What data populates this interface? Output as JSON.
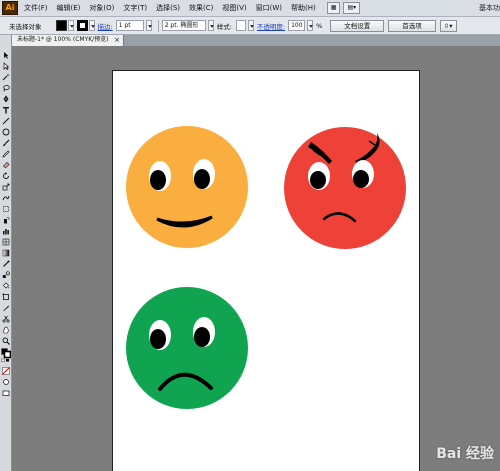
{
  "menubar": {
    "logo": "Ai",
    "items": [
      "文件(F)",
      "编辑(E)",
      "对象(O)",
      "文字(T)",
      "选择(S)",
      "效果(C)",
      "视图(V)",
      "窗口(W)",
      "帮助(H)"
    ],
    "workspace_label": "基本功"
  },
  "control_bar": {
    "selection": "未选择对象",
    "stroke_label": "描边:",
    "stroke_weight": "1 pt",
    "brush": "2 pt. 椭圆形",
    "style_label": "样式:",
    "opacity_label": "不透明度:",
    "opacity_value": "100",
    "percent": "%",
    "doc_setup_button": "文档设置",
    "prefs_button": "首选项"
  },
  "document_tab": {
    "title": "未标题-1* @ 100% (CMYK/预览)",
    "close": "×"
  },
  "watermark": "Bai 经验",
  "colors": {
    "happy_face": "#f9ae3f",
    "angry_face": "#ee4137",
    "sad_face": "#10a450",
    "feature": "#000000",
    "eye_white": "#ffffff"
  }
}
